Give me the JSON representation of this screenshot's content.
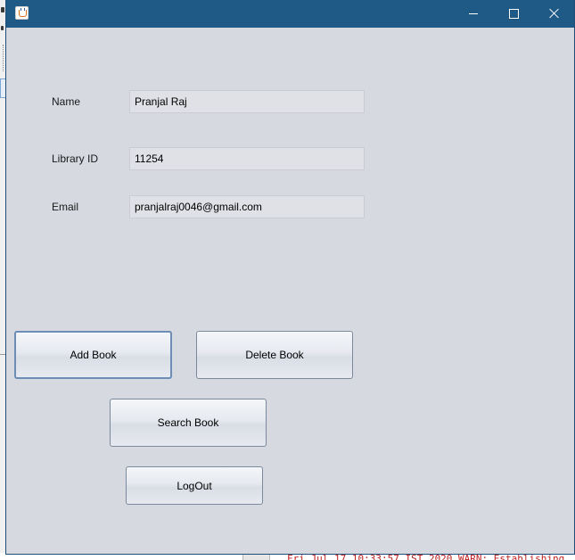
{
  "window": {
    "controls": {
      "minimize_icon": "minimize-icon",
      "maximize_icon": "maximize-icon",
      "close_icon": "close-icon"
    },
    "app_icon": "java-cup-icon"
  },
  "form": {
    "name_label": "Name",
    "name_value": "Pranjal Raj",
    "library_id_label": "Library ID",
    "library_id_value": "11254",
    "email_label": "Email",
    "email_value": "pranjalraj0046@gmail.com"
  },
  "buttons": {
    "add_book": "Add Book",
    "delete_book": "Delete Book",
    "search_book": "Search Book",
    "logout": "LogOut"
  },
  "background": {
    "console_line": "Fri Jul 17 10:33:57 IST 2020 WARN: Establishing"
  },
  "colors": {
    "titlebar": "#1f5a87",
    "window_bg": "#d6d9e0",
    "console_text": "#c02020"
  }
}
